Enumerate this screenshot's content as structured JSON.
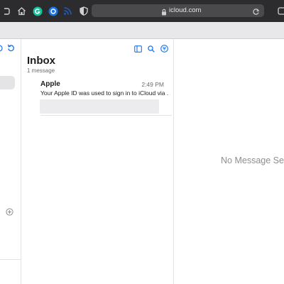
{
  "browser": {
    "url": "icloud.com",
    "icons": [
      "home-icon",
      "grammarly-extension-icon",
      "extension-icon",
      "rss-icon",
      "privacy-shield-icon",
      "lock-icon",
      "reload-icon"
    ]
  },
  "colors": {
    "toolbar": "#2c2c2e",
    "address_bar": "#4a4a4c",
    "accent": "#1a73e8",
    "grammarly": "#15c39a"
  },
  "sidebar": {
    "icons": [
      "mailbox-icon",
      "refresh-icon",
      "add-folder-icon"
    ]
  },
  "mailbox": {
    "title": "Inbox",
    "count": "1 message",
    "toolbar_icons": [
      "sidebar-toggle-icon",
      "search-icon",
      "filter-icon"
    ]
  },
  "messages": [
    {
      "sender": "Apple",
      "time": "2:49 PM",
      "subject": "Your Apple ID was used to sign in to iCloud via ..."
    }
  ],
  "detail": {
    "empty_text": "No Message Se"
  }
}
